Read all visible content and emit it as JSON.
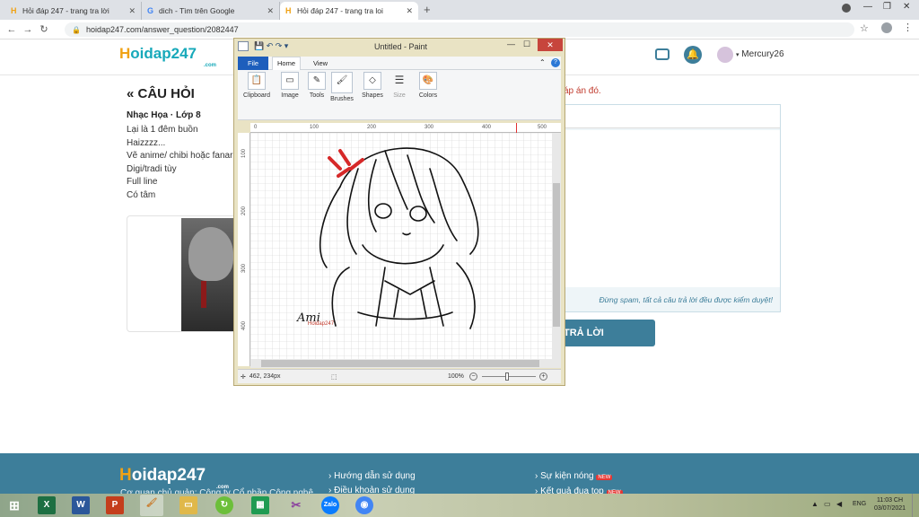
{
  "browser": {
    "tabs": [
      {
        "title": "Hỏi đáp 247 - trang tra lời",
        "favicon": "H"
      },
      {
        "title": "dich - Tìm trên Google",
        "favicon": "G"
      },
      {
        "title": "Hỏi đáp 247 - trang tra loi",
        "favicon": "H"
      }
    ],
    "url": "hoidap247.com/answer_question/2082447"
  },
  "site": {
    "logo": "oidap247",
    "logo_h": "H",
    "logo_sub": ".com",
    "username": "Mercury26",
    "question_header": "« CÂU HỎI",
    "subject": "Nhạc Họa · Lớp 8",
    "question_lines": [
      "Lại là 1 đêm buồn",
      "Haizzzz...",
      "Vẽ anime/ chibi hoặc fanar",
      "Digi/tradi tùy",
      "Full line",
      "Có tâm"
    ],
    "right_hint": "áp án đó.",
    "spam_notice": "Đừng spam, tất cả câu trả lời đều được kiểm duyệt!",
    "submit_label": "TRẢ LỜI"
  },
  "footer": {
    "logo": "oidap247",
    "logo_h": "H",
    "logo_sub": ".com",
    "owner": "Cơ quan chủ quản: Công ty Cổ phần Công nghệ",
    "links_left": [
      "Hướng dẫn sử dụng",
      "Điều khoản sử dụng"
    ],
    "links_right": [
      "Sự kiện nóng",
      "Kết quả đua top"
    ],
    "new_badge": "NEW"
  },
  "paint": {
    "title": "Untitled - Paint",
    "tabs": [
      "File",
      "Home",
      "View"
    ],
    "groups": [
      "Clipboard",
      "Image",
      "Tools",
      "Brushes",
      "Shapes",
      "Size",
      "Colors"
    ],
    "ruler_h": [
      "0",
      "100",
      "200",
      "300",
      "400",
      "500"
    ],
    "ruler_v": [
      "100",
      "200",
      "300",
      "400"
    ],
    "cursor_pos": "462, 234px",
    "zoom": "100%",
    "signature": "Ami",
    "watermark": "Hoidap247"
  },
  "taskbar": {
    "lang": "ENG",
    "time": "11:03 CH",
    "date": "03/07/2021"
  },
  "colors": {
    "accent": "#3d7e9a",
    "logo_blue": "#17a9ba",
    "logo_orange": "#f0a215",
    "paint_file_tab": "#1e5ebc"
  }
}
